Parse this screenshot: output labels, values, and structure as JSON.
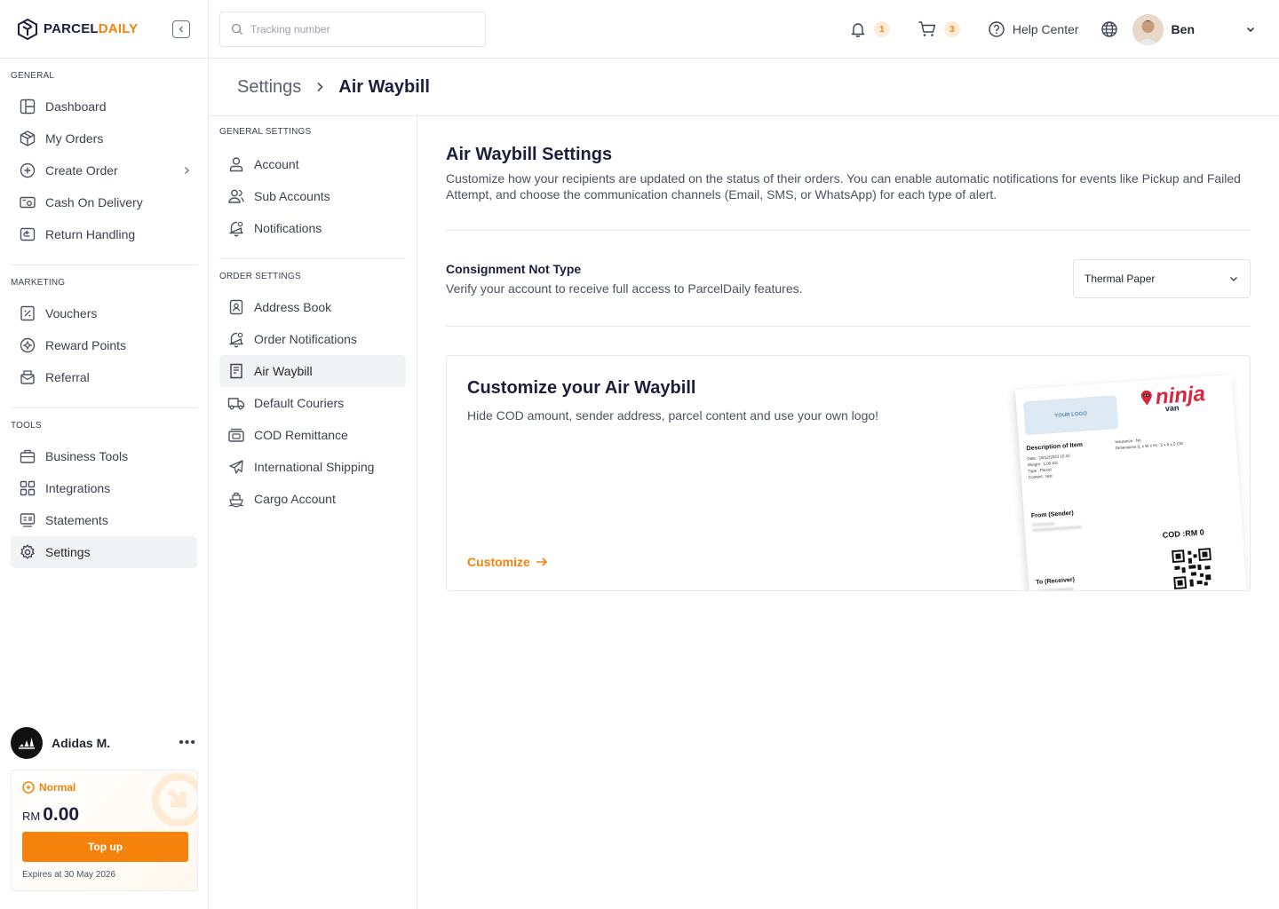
{
  "brand": {
    "part1": "PARCEL",
    "part2": "DAILY"
  },
  "colors": {
    "accent": "#f5820b",
    "navy": "#1b1f3b",
    "border": "#e6e8ec"
  },
  "sidebar": {
    "sections": [
      {
        "title": "GENERAL",
        "items": [
          {
            "label": "Dashboard",
            "icon": "dashboard-icon"
          },
          {
            "label": "My Orders",
            "icon": "box-icon"
          },
          {
            "label": "Create Order",
            "icon": "plus-circle-icon"
          },
          {
            "label": "Cash On Delivery",
            "icon": "cash-icon"
          },
          {
            "label": "Return Handling",
            "icon": "return-icon"
          }
        ]
      },
      {
        "title": "MARKETING",
        "items": [
          {
            "label": "Vouchers",
            "icon": "voucher-icon"
          },
          {
            "label": "Reward Points",
            "icon": "reward-icon"
          },
          {
            "label": "Referral",
            "icon": "referral-icon"
          }
        ]
      },
      {
        "title": "TOOLS",
        "items": [
          {
            "label": "Business Tools",
            "icon": "briefcase-icon"
          },
          {
            "label": "Integrations",
            "icon": "integrations-icon"
          },
          {
            "label": "Statements",
            "icon": "statements-icon"
          },
          {
            "label": "Settings",
            "icon": "gear-icon"
          }
        ]
      }
    ],
    "account": {
      "name": "Adidas M.",
      "more": "•••"
    },
    "wallet": {
      "tier": "Normal",
      "currency": "RM",
      "amount": "0.00",
      "topup_label": "Top up",
      "expiry": "Expires at 30 May 2026"
    }
  },
  "topbar": {
    "search_placeholder": "Tracking number",
    "notifications_count": "1",
    "cart_count": "3",
    "help_label": "Help Center",
    "user_name": "Ben"
  },
  "breadcrumb": {
    "parent": "Settings",
    "current": "Air Waybill"
  },
  "subnav": {
    "sections": [
      {
        "title": "GENERAL SETTINGS",
        "items": [
          {
            "label": "Account",
            "icon": "user-icon"
          },
          {
            "label": "Sub Accounts",
            "icon": "users-icon"
          },
          {
            "label": "Notifications",
            "icon": "bell-settings-icon"
          }
        ]
      },
      {
        "title": "ORDER SETTINGS",
        "items": [
          {
            "label": "Address Book",
            "icon": "address-book-icon"
          },
          {
            "label": "Order Notifications",
            "icon": "bell-settings-icon"
          },
          {
            "label": "Air Waybill",
            "icon": "waybill-icon"
          },
          {
            "label": "Default Couriers",
            "icon": "truck-icon"
          },
          {
            "label": "COD Remittance",
            "icon": "remittance-icon"
          },
          {
            "label": "International Shipping",
            "icon": "plane-icon"
          },
          {
            "label": "Cargo Account",
            "icon": "cargo-icon"
          }
        ]
      }
    ]
  },
  "main": {
    "title": "Air Waybill Settings",
    "description": "Customize how your recipients are updated on the status of their orders. You can enable automatic notifications for events like Pickup and Failed Attempt, and choose the communication channels (Email, SMS, or WhatsApp) for each type of alert.",
    "consignment": {
      "title": "Consignment Not Type",
      "description": "Verify your account to receive full access to ParcelDaily features.",
      "selected": "Thermal Paper"
    },
    "card": {
      "title": "Customize your Air Waybill",
      "description": "Hide COD amount, sender address, parcel content and use your own logo!",
      "cta": "Customize",
      "preview": {
        "your_logo": "YOUR LOGO",
        "courier_name": "ninja",
        "courier_sub": "van",
        "description_heading": "Description of Item",
        "date": "Date     : 18/12/2023 15:32",
        "weight": "Weight  : 1.00 KG",
        "type": "Type     : Parcel",
        "content": "Content : test",
        "insurance": "Insurance : No",
        "dimensions": "Dimensions (L x W x H) : 5 x 5 x 5 CM",
        "from_label": "From (Sender)",
        "cod": "COD :RM 0",
        "to_label": "To (Receiver)"
      }
    }
  }
}
